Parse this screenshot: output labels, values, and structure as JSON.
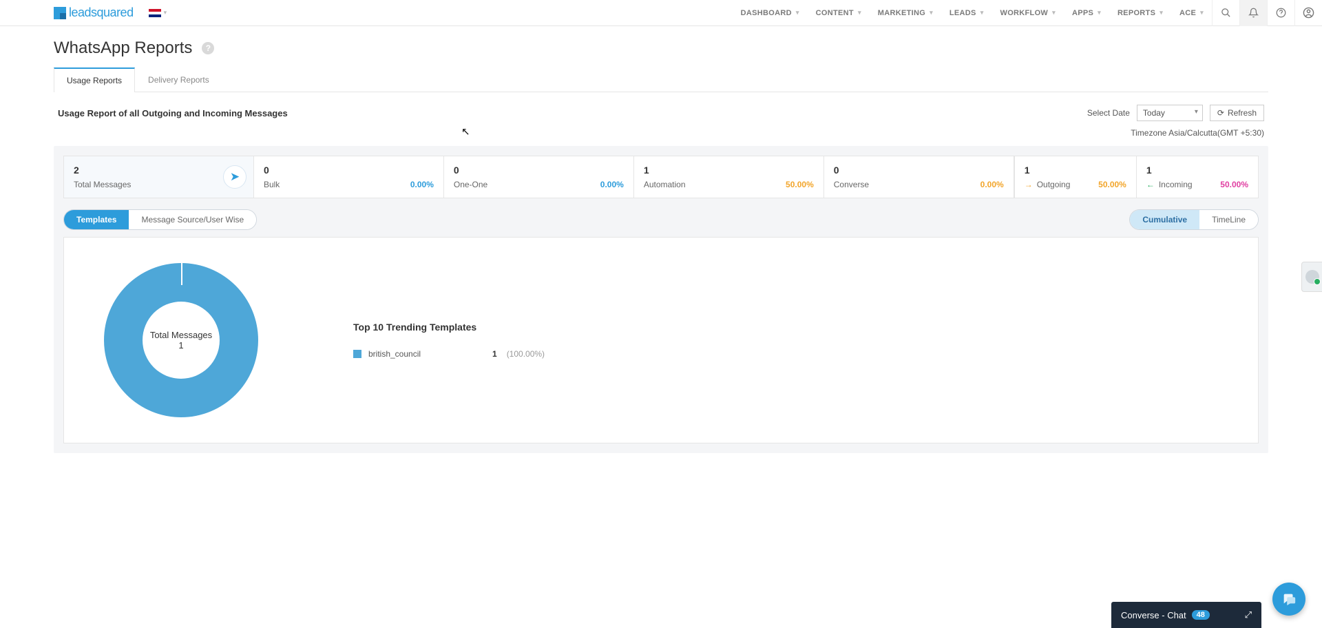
{
  "brand": {
    "name": "leadsquared"
  },
  "nav": {
    "items": [
      "DASHBOARD",
      "CONTENT",
      "MARKETING",
      "LEADS",
      "WORKFLOW",
      "APPS",
      "REPORTS",
      "ACE"
    ]
  },
  "page": {
    "title": "WhatsApp Reports",
    "tabs": {
      "usage": "Usage Reports",
      "delivery": "Delivery Reports"
    },
    "subtitle": "Usage Report of all Outgoing and Incoming Messages",
    "select_date_label": "Select Date",
    "date_value": "Today",
    "refresh": "Refresh",
    "timezone_label": "Timezone",
    "timezone_value": "Asia/Calcutta(GMT +5:30)"
  },
  "stats": {
    "total": {
      "value": "2",
      "label": "Total Messages"
    },
    "bulk": {
      "value": "0",
      "label": "Bulk",
      "pct": "0.00%"
    },
    "one_one": {
      "value": "0",
      "label": "One-One",
      "pct": "0.00%"
    },
    "automation": {
      "value": "1",
      "label": "Automation",
      "pct": "50.00%"
    },
    "converse": {
      "value": "0",
      "label": "Converse",
      "pct": "0.00%"
    },
    "outgoing": {
      "value": "1",
      "label": "Outgoing",
      "pct": "50.00%"
    },
    "incoming": {
      "value": "1",
      "label": "Incoming",
      "pct": "50.00%"
    }
  },
  "pills": {
    "left": {
      "templates": "Templates",
      "msw": "Message Source/User Wise"
    },
    "right": {
      "cumulative": "Cumulative",
      "timeline": "TimeLine"
    }
  },
  "chart": {
    "center_label": "Total Messages 1",
    "legend_title": "Top 10 Trending Templates",
    "rows": [
      {
        "name": "british_council",
        "count": "1",
        "pct": "(100.00%)"
      }
    ]
  },
  "chart_data": {
    "type": "pie",
    "title": "Top 10 Trending Templates",
    "categories": [
      "british_council"
    ],
    "values": [
      1
    ],
    "total_label": "Total Messages",
    "total": 1
  },
  "converse": {
    "label": "Converse - Chat",
    "badge": "48"
  }
}
